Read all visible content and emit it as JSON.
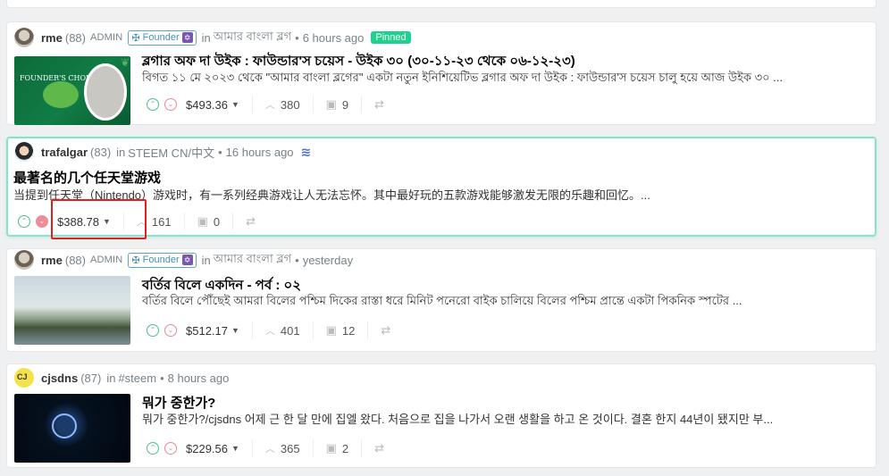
{
  "posts": [
    {
      "author": "rme",
      "reputation": "(88)",
      "admin_label": "ADMIN",
      "founder_label": "Founder",
      "in_label": "in",
      "community": "আমার বাংলা ব্লগ",
      "time": "6 hours ago",
      "pinned": "Pinned",
      "title": "ব্লগার অফ দা উইক : ফাউন্ডার'স চয়েস - উইক ৩০ (৩০-১১-২৩ থেকে ০৬-১২-২৩)",
      "summary": "বিগত ১১ মে ২০২৩ থেকে \"আমার বাংলা ব্লগের\" একটা নতুন ইনিশিয়েটিভ ব্লগার অফ দা উইক : ফাউন্ডার'স চয়েস চালু হয়ে আজ উইক ৩০ ...",
      "payout": "$493.36",
      "votes": "380",
      "comments": "9",
      "thumb_text": "FOUNDER'S CHOICE"
    },
    {
      "author": "trafalgar",
      "reputation": "(83)",
      "in_label": "in",
      "community": "STEEM CN/中文",
      "time": "16 hours ago",
      "title": "最著名的几个任天堂游戏",
      "summary": "当提到任天堂（Nintendo）游戏时，有一系列经典游戏让人无法忘怀。其中最好玩的五款游戏能够激发无限的乐趣和回忆。...",
      "payout": "$388.78",
      "votes": "161",
      "comments": "0"
    },
    {
      "author": "rme",
      "reputation": "(88)",
      "admin_label": "ADMIN",
      "founder_label": "Founder",
      "in_label": "in",
      "community": "আমার বাংলা ব্লগ",
      "time": "yesterday",
      "title": "বর্তির বিলে একদিন - পর্ব : ০২",
      "summary": "বর্তির বিলে পৌঁছেই আমরা বিলের পশ্চিম দিকের রাস্তা ধরে মিনিট পনেরো বাইক চালিয়ে বিলের পশ্চিম প্রান্তে একটা পিকনিক স্পটের ...",
      "payout": "$512.17",
      "votes": "401",
      "comments": "12"
    },
    {
      "author": "cjsdns",
      "reputation": "(87)",
      "in_label": "in",
      "community": "#steem",
      "time": "8 hours ago",
      "title": "뭐가 중한가?",
      "summary": "뭐가 중한가?/cjsdns 어제 근 한 달 만에 집엘 왔다. 처음으로 집을 나가서 오랜 생활을 하고 온 것이다. 결혼 한지 44년이 됐지만 부...",
      "payout": "$229.56",
      "votes": "365",
      "comments": "2"
    }
  ],
  "colors": {
    "upvote": "#4dbf8a",
    "downvote": "#e98a95",
    "pinned_bg": "#1fd18e",
    "active_border": "#7ee8cf",
    "highlight": "#e02020"
  },
  "icons": {
    "upvote": "chevron-up-circle-icon",
    "downvote": "chevron-down-circle-icon",
    "votes": "chevron-up-icon",
    "comments": "comment-icon",
    "reblog": "reblog-icon"
  }
}
